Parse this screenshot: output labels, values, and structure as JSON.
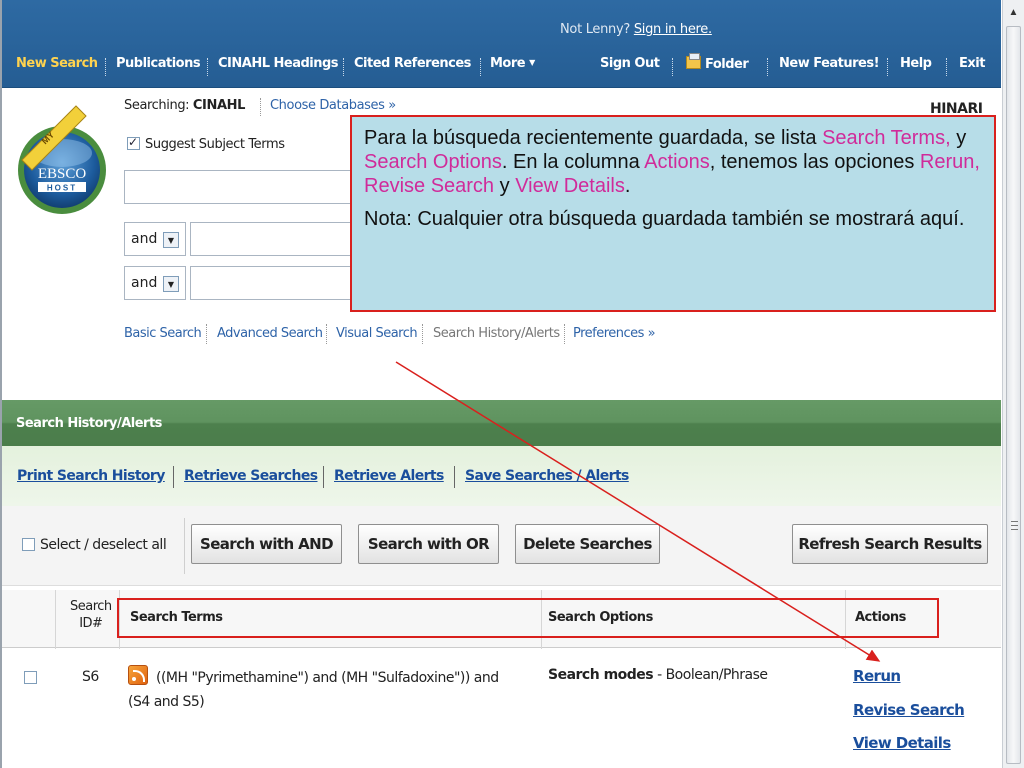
{
  "header": {
    "user_prefix": "Not Lenny?",
    "sign_in_link": "Sign in here.",
    "nav": {
      "new_search": "New Search",
      "publications": "Publications",
      "cinahl_headings": "CINAHL Headings",
      "cited_references": "Cited References",
      "more": "More",
      "sign_out": "Sign Out",
      "folder": "Folder",
      "new_features": "New Features!",
      "help": "Help",
      "exit": "Exit"
    }
  },
  "search": {
    "searching_label": "Searching:",
    "database": "CINAHL",
    "choose_databases": "Choose Databases »",
    "institution": "HINARI",
    "suggest_label": "Suggest Subject Terms",
    "suggest_checked": true,
    "operator_1": "and",
    "operator_2": "and",
    "query_1": "",
    "query_2": "",
    "query_3": "",
    "modes": {
      "basic": "Basic Search",
      "advanced": "Advanced Search",
      "visual": "Visual Search",
      "history": "Search History/Alerts",
      "preferences": "Preferences »"
    }
  },
  "callout": {
    "p1_a": "Para la búsqueda recientemente guardada, se lista ",
    "p1_search_terms": "Search Terms,",
    "p1_b": " y ",
    "p1_search_options": "Search Options",
    "p1_c": ".  En la columna ",
    "p1_actions": "Actions",
    "p1_d": ", tenemos las opciones ",
    "p1_rerun": "Rerun, Revise Search",
    "p1_e": " y ",
    "p1_view": "View Details",
    "p1_f": ".",
    "p2": "Nota: Cualquier otra búsqueda guardada también se mostrará aquí.",
    "highlight_color": "#d02b9a",
    "border_color": "#d9201d"
  },
  "history": {
    "title": "Search History/Alerts",
    "links": {
      "print": "Print Search History",
      "retrieve_searches": "Retrieve Searches",
      "retrieve_alerts": "Retrieve Alerts",
      "save": "Save Searches / Alerts"
    },
    "toolbar": {
      "select_all": "Select / deselect all",
      "search_and": "Search with AND",
      "search_or": "Search with OR",
      "delete": "Delete Searches",
      "refresh": "Refresh Search Results"
    },
    "columns": {
      "id_line1": "Search",
      "id_line2": "ID#",
      "terms": "Search Terms",
      "options": "Search Options",
      "actions": "Actions"
    },
    "rows": [
      {
        "id": "S6",
        "terms_line1": "((MH \"Pyrimethamine\") and (MH \"Sulfadoxine\")) and",
        "terms_line2": "(S4 and S5)",
        "options_label": "Search modes",
        "options_value": " - Boolean/Phrase",
        "actions": [
          "Rerun",
          "Revise Search",
          "View Details"
        ]
      }
    ]
  },
  "colors": {
    "header_blue": "#2e6aa3",
    "band_green": "#5f935f",
    "link_blue": "#1a4e9c"
  }
}
